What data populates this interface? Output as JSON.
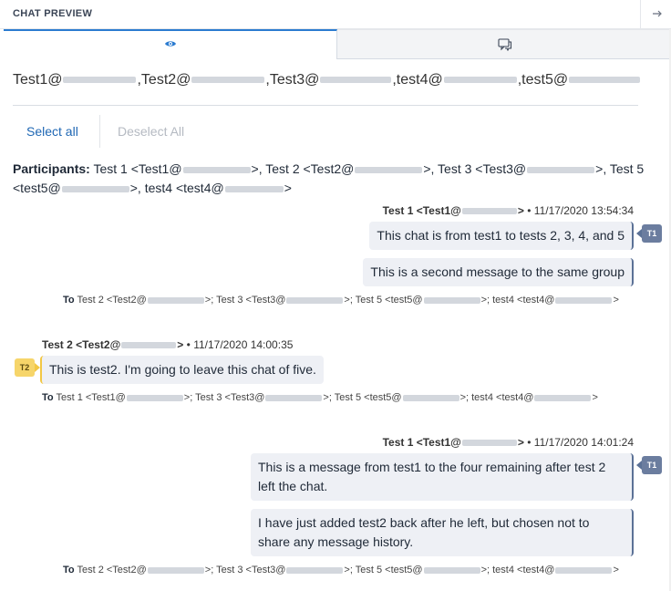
{
  "header": {
    "title": "CHAT PREVIEW",
    "collapse_icon": "arrow-right-icon"
  },
  "tabs": [
    {
      "icon": "eye-icon",
      "active": true
    },
    {
      "icon": "chat-bubble-icon",
      "active": false
    }
  ],
  "recipients": [
    "Test1@",
    ",Test2@",
    ",Test3@",
    ",test4@",
    ",test5@"
  ],
  "actions": {
    "select_all": "Select all",
    "deselect_all": "Deselect All"
  },
  "participants": {
    "label": "Participants:",
    "p1": "Test 1 <Test1@",
    "p2": ">, Test 2 <Test2@",
    "p3": ">, Test 3 <Test3@",
    "p4": ">, Test 5",
    "p5": "<test5@",
    "p6": ">, test4 <test4@",
    "p7": ">"
  },
  "groups": [
    {
      "sender_name": "Test 1 <Test1@",
      "sender_tail": ">",
      "timestamp": "11/17/2020 13:54:34",
      "avatar": "T1",
      "messages": [
        "This chat is from test1 to tests 2, 3, 4, and 5",
        "This is a second message to the same group"
      ],
      "to": {
        "label": "To",
        "a": "Test 2 <Test2@",
        "b": ">; Test 3 <Test3@",
        "c": ">; Test 5 <test5@",
        "d": ">; test4 <test4@",
        "e": ">"
      }
    },
    {
      "sender_name": "Test 2 <Test2@",
      "sender_tail": ">",
      "timestamp": "11/17/2020 14:00:35",
      "avatar": "T2",
      "messages": [
        "This is test2. I'm going to leave this chat of five."
      ],
      "to": {
        "label": "To",
        "a": "Test 1 <Test1@",
        "b": ">; Test 3 <Test3@",
        "c": ">; Test 5 <test5@",
        "d": ">; test4 <test4@",
        "e": ">"
      }
    },
    {
      "sender_name": "Test 1 <Test1@",
      "sender_tail": ">",
      "timestamp": "11/17/2020 14:01:24",
      "avatar": "T1",
      "messages": [
        "This is a message from test1 to the four remaining after test 2 left the chat.",
        "I have just added test2 back after he left, but chosen not to share any message history."
      ],
      "to": {
        "label": "To",
        "a": "Test 2 <Test2@",
        "b": ">; Test 3 <Test3@",
        "c": ">; Test 5 <test5@",
        "d": ">; test4 <test4@",
        "e": ">"
      }
    }
  ],
  "separator": "•"
}
